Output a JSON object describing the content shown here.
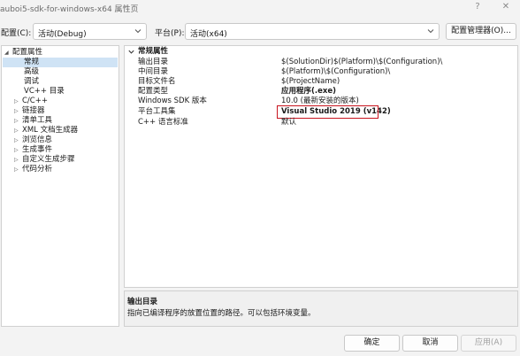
{
  "window": {
    "title": "auboi5-sdk-for-windows-x64 属性页",
    "help_glyph": "?",
    "close_glyph": "✕"
  },
  "config_bar": {
    "config_label": "配置(C):",
    "config_value": "活动(Debug)",
    "platform_label": "平台(P):",
    "platform_value": "活动(x64)",
    "manager_button": "配置管理器(O)..."
  },
  "tree": {
    "root": "配置属性",
    "children": [
      "常规",
      "高级",
      "调试",
      "VC++ 目录"
    ],
    "groups": [
      "C/C++",
      "链接器",
      "清单工具",
      "XML 文档生成器",
      "浏览信息",
      "生成事件",
      "自定义生成步骤",
      "代码分析"
    ]
  },
  "grid": {
    "category": "常规属性",
    "rows": [
      {
        "key": "输出目录",
        "value": "$(SolutionDir)$(Platform)\\$(Configuration)\\"
      },
      {
        "key": "中间目录",
        "value": "$(Platform)\\$(Configuration)\\"
      },
      {
        "key": "目标文件名",
        "value": "$(ProjectName)"
      },
      {
        "key": "配置类型",
        "value": "应用程序(.exe)"
      },
      {
        "key": "Windows SDK 版本",
        "value": "10.0 (最新安装的版本)"
      },
      {
        "key": "平台工具集",
        "value": "Visual Studio 2019 (v142)"
      },
      {
        "key": "C++ 语言标准",
        "value": "默认"
      }
    ]
  },
  "description": {
    "title": "输出目录",
    "text": "指向已编译程序的放置位置的路径。可以包括环境变量。"
  },
  "buttons": {
    "ok": "确定",
    "cancel": "取消",
    "apply": "应用(A)"
  },
  "colors": {
    "selection": "#cfe3f5",
    "highlight_border": "#c8141e"
  }
}
